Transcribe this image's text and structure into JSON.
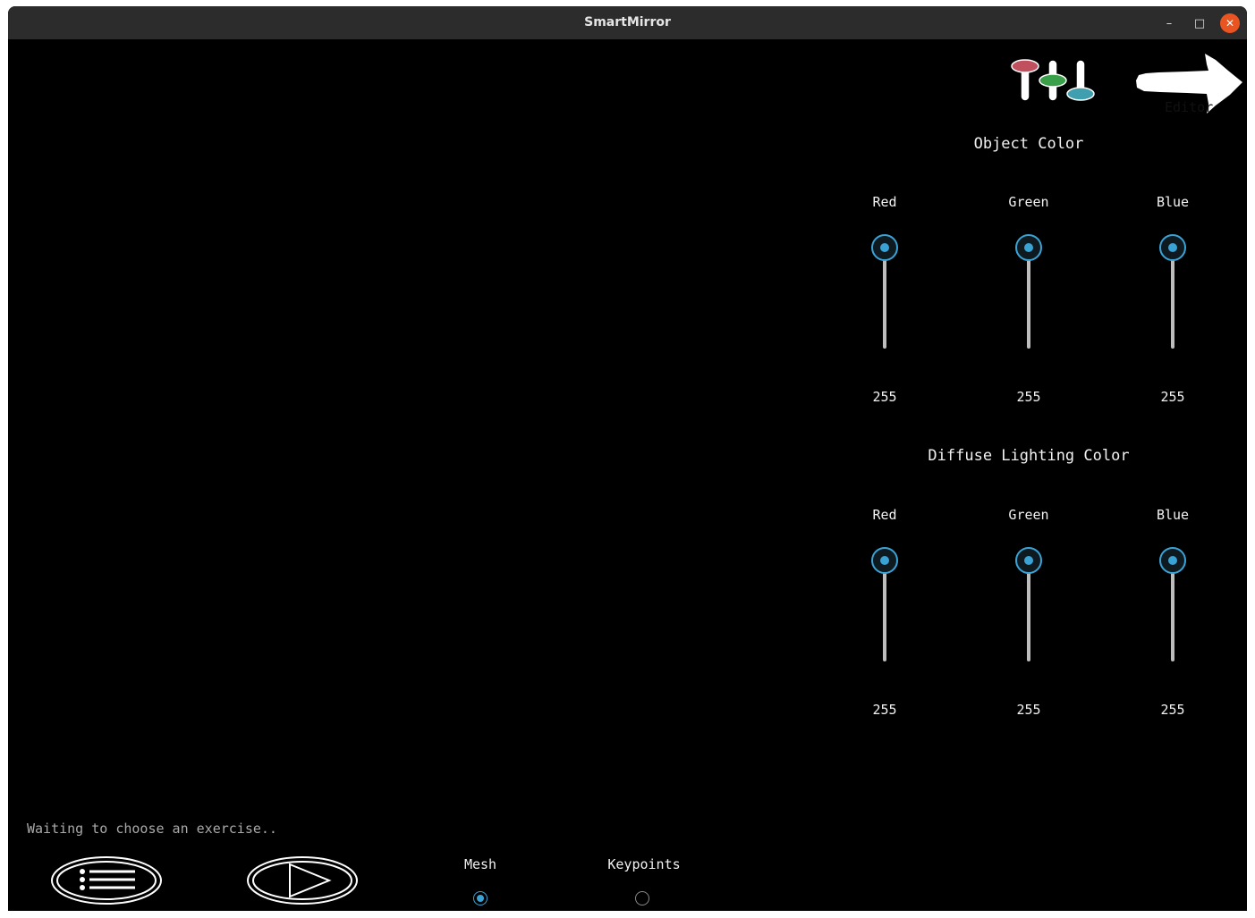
{
  "window": {
    "title": "SmartMirror"
  },
  "editor": {
    "label": "Editor"
  },
  "object_color": {
    "title": "Object Color",
    "channels": [
      {
        "label": "Red",
        "value": "255",
        "level": 255
      },
      {
        "label": "Green",
        "value": "255",
        "level": 255
      },
      {
        "label": "Blue",
        "value": "255",
        "level": 255
      }
    ]
  },
  "diffuse_color": {
    "title": "Diffuse Lighting Color",
    "channels": [
      {
        "label": "Red",
        "value": "255",
        "level": 255
      },
      {
        "label": "Green",
        "value": "255",
        "level": 255
      },
      {
        "label": "Blue",
        "value": "255",
        "level": 255
      }
    ]
  },
  "status": {
    "text": "Waiting to choose an exercise.."
  },
  "render_mode": {
    "options": [
      {
        "label": "Mesh",
        "selected": true
      },
      {
        "label": "Keypoints",
        "selected": false
      }
    ]
  },
  "colors": {
    "accent": "#3aa3d6",
    "close": "#e95420",
    "slider_red": "#c0505e",
    "slider_green": "#3aa14a",
    "slider_teal": "#3f9fae"
  },
  "icons": [
    "minimize-icon",
    "maximize-icon",
    "close-icon",
    "sliders-icon",
    "arrow-icon",
    "list-menu-icon",
    "play-icon"
  ]
}
